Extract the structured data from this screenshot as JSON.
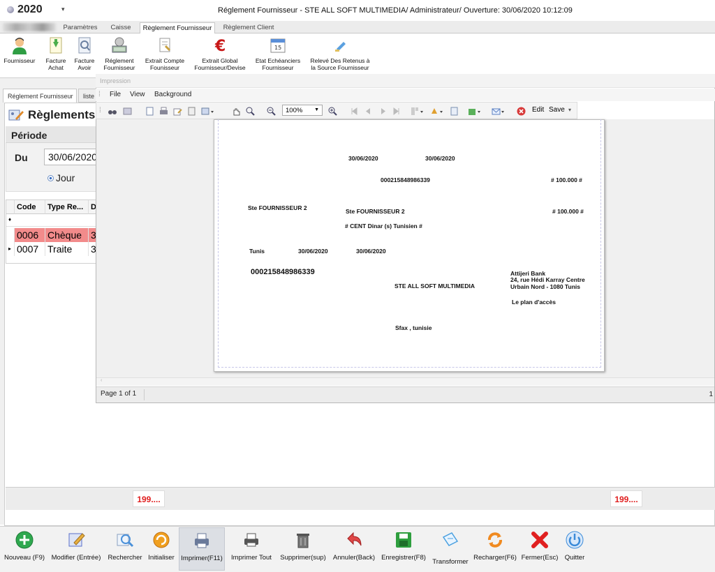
{
  "app": {
    "year": "2020",
    "quick_access": "▾",
    "window_title": "Réglement Fournisseur - STE ALL SOFT MULTIMEDIA/ Administrateur/ Ouverture: 30/06/2020 10:12:09"
  },
  "ribbon_tabs": [
    "Paramètres",
    "Caisse",
    "Règlement Fournisseur",
    "Règlement Client"
  ],
  "ribbon_buttons": [
    {
      "label1": "Fournisseur",
      "label2": "",
      "icon": "user-icon"
    },
    {
      "label1": "Facture",
      "label2": "Achat",
      "icon": "invoice-in-icon"
    },
    {
      "label1": "Facture",
      "label2": "Avoir",
      "icon": "invoice-credit-icon"
    },
    {
      "label1": "Réglement",
      "label2": "Fournisseur",
      "icon": "money-icon"
    },
    {
      "label1": "Extrait Compte",
      "label2": "Founisseur",
      "icon": "statement-icon"
    },
    {
      "label1": "Extrait Global",
      "label2": "Fournisseur/Devise",
      "icon": "euro-icon"
    },
    {
      "label1": "Etat Echéanciers",
      "label2": "Fournisseur",
      "icon": "calendar-icon"
    },
    {
      "label1": "Relevé Des Retenus à",
      "label2": "la Source Fournisseur",
      "icon": "report-icon"
    }
  ],
  "calendar_day": "15",
  "doc_tabs": [
    "Réglement Fournisseur",
    "liste"
  ],
  "panel": {
    "title": "Règlements",
    "period_label": "Période",
    "du_label": "Du",
    "date_value": "30/06/2020",
    "jour_label": "Jour"
  },
  "grid": {
    "headers": [
      "Code",
      "Type Re...",
      "D"
    ],
    "rows": [
      {
        "code": "0006",
        "type": "Chèque",
        "d": "3",
        "highlight": "#f28b8b"
      },
      {
        "code": "0007",
        "type": "Traite",
        "d": "3",
        "highlight": ""
      }
    ]
  },
  "totals": {
    "left": "199....",
    "right": "199...."
  },
  "impression": {
    "title": "Impression",
    "menu": [
      "File",
      "View",
      "Background"
    ],
    "zoom": "100%",
    "edit_label": "Edit",
    "save_label": "Save",
    "page_info": "Page 1 of 1",
    "status_right": "1"
  },
  "cheque": {
    "date1": "30/06/2020",
    "date2": "30/06/2020",
    "account_top": "000215848986339",
    "amount1": "# 100.000 #",
    "supplier_left": "Ste FOURNISSEUR 2",
    "supplier_mid": "Ste FOURNISSEUR 2",
    "amount2": "# 100.000 #",
    "amount_words": "# CENT  Dinar (s) Tunisien #",
    "city": "Tunis",
    "date3": "30/06/2020",
    "date4": "30/06/2020",
    "account_big": "000215848986339",
    "company": "STE ALL SOFT MULTIMEDIA",
    "bank_name": "Attijeri Bank",
    "bank_addr1": "24, rue Hédi Karray Centre",
    "bank_addr2": "Urbain Nord - 1080 Tunis",
    "access": "Le plan d'accès",
    "company_city": "Sfax , tunisie"
  },
  "bottom_buttons": [
    {
      "label": "Nouveau (F9)",
      "icon": "add-icon",
      "color": "#2fa84f"
    },
    {
      "label": "Modifier (Entrée)",
      "icon": "edit-icon",
      "color": "#5a6fc9"
    },
    {
      "label": "Rechercher",
      "icon": "search-icon",
      "color": "#4a90d9"
    },
    {
      "label": "Initialiser",
      "icon": "reset-icon",
      "color": "#f0a020"
    },
    {
      "label": "Imprimer(F11)",
      "icon": "printer-icon",
      "color": "#6a7a9a"
    },
    {
      "label": "Imprimer Tout",
      "icon": "print-all-icon",
      "color": "#555"
    },
    {
      "label": "Supprimer(sup)",
      "icon": "trash-icon",
      "color": "#666"
    },
    {
      "label": "Annuler(Back)",
      "icon": "undo-icon",
      "color": "#e04848"
    },
    {
      "label": "Enregistrer(F8)",
      "icon": "save-icon",
      "color": "#2e9e3e"
    },
    {
      "label": "Transformer",
      "icon": "transform-icon",
      "color": "#4aa0e0"
    },
    {
      "label": "Recharger(F6)",
      "icon": "reload-icon",
      "color": "#f08a20"
    },
    {
      "label": "Fermer(Esc)",
      "icon": "close-icon",
      "color": "#e02020"
    },
    {
      "label": "Quitter",
      "icon": "power-icon",
      "color": "#3a8ad8"
    }
  ]
}
